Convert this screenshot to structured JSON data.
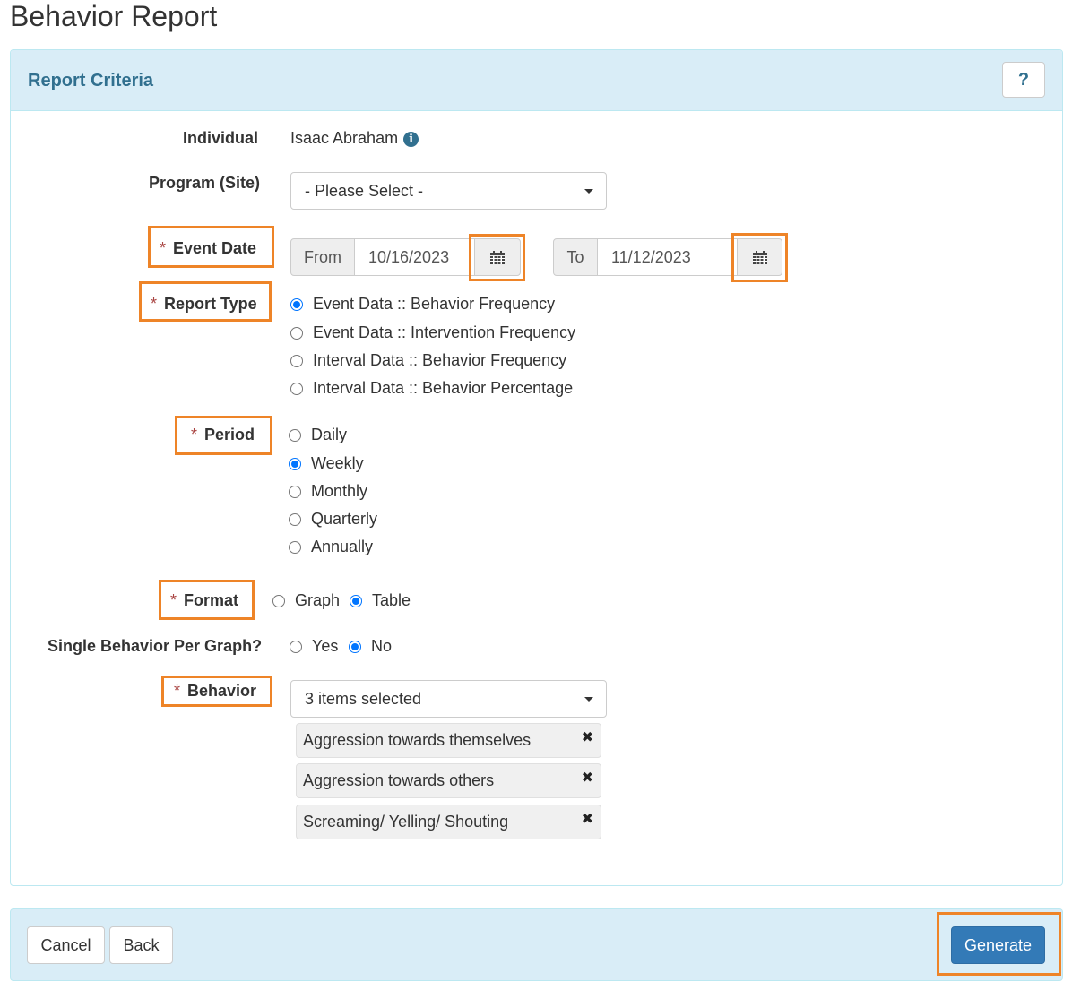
{
  "page": {
    "title": "Behavior Report"
  },
  "panel": {
    "title": "Report Criteria",
    "help_label": "?"
  },
  "form": {
    "individual": {
      "label": "Individual",
      "value": "Isaac Abraham",
      "info_icon": "i"
    },
    "program": {
      "label": "Program (Site)",
      "selected": "- Please Select -"
    },
    "event_date": {
      "required_mark": "*",
      "label": "Event Date",
      "from_label": "From",
      "from_value": "10/16/2023",
      "to_label": "To",
      "to_value": "11/12/2023"
    },
    "report_type": {
      "required_mark": "*",
      "label": "Report Type",
      "options": [
        "Event Data :: Behavior Frequency",
        "Event Data :: Intervention Frequency",
        "Interval Data :: Behavior Frequency",
        "Interval Data :: Behavior Percentage"
      ],
      "selected": "Event Data :: Behavior Frequency"
    },
    "period": {
      "required_mark": "*",
      "label": "Period",
      "options": [
        "Daily",
        "Weekly",
        "Monthly",
        "Quarterly",
        "Annually"
      ],
      "selected": "Weekly"
    },
    "format": {
      "required_mark": "*",
      "label": "Format",
      "options": [
        "Graph",
        "Table"
      ],
      "selected": "Table"
    },
    "single_behavior": {
      "label": "Single Behavior Per Graph?",
      "options": [
        "Yes",
        "No"
      ],
      "selected": "No"
    },
    "behavior": {
      "required_mark": "*",
      "label": "Behavior",
      "summary": "3 items selected",
      "selected_items": [
        "Aggression towards themselves",
        "Aggression towards others",
        "Screaming/ Yelling/ Shouting"
      ],
      "remove_symbol": "✖"
    }
  },
  "footer": {
    "cancel_label": "Cancel",
    "back_label": "Back",
    "generate_label": "Generate"
  },
  "colors": {
    "accent": "#31708f",
    "panel_bg": "#d9edf7",
    "highlight": "#ee8428",
    "primary": "#337ab7",
    "radio": "#0075ff"
  }
}
